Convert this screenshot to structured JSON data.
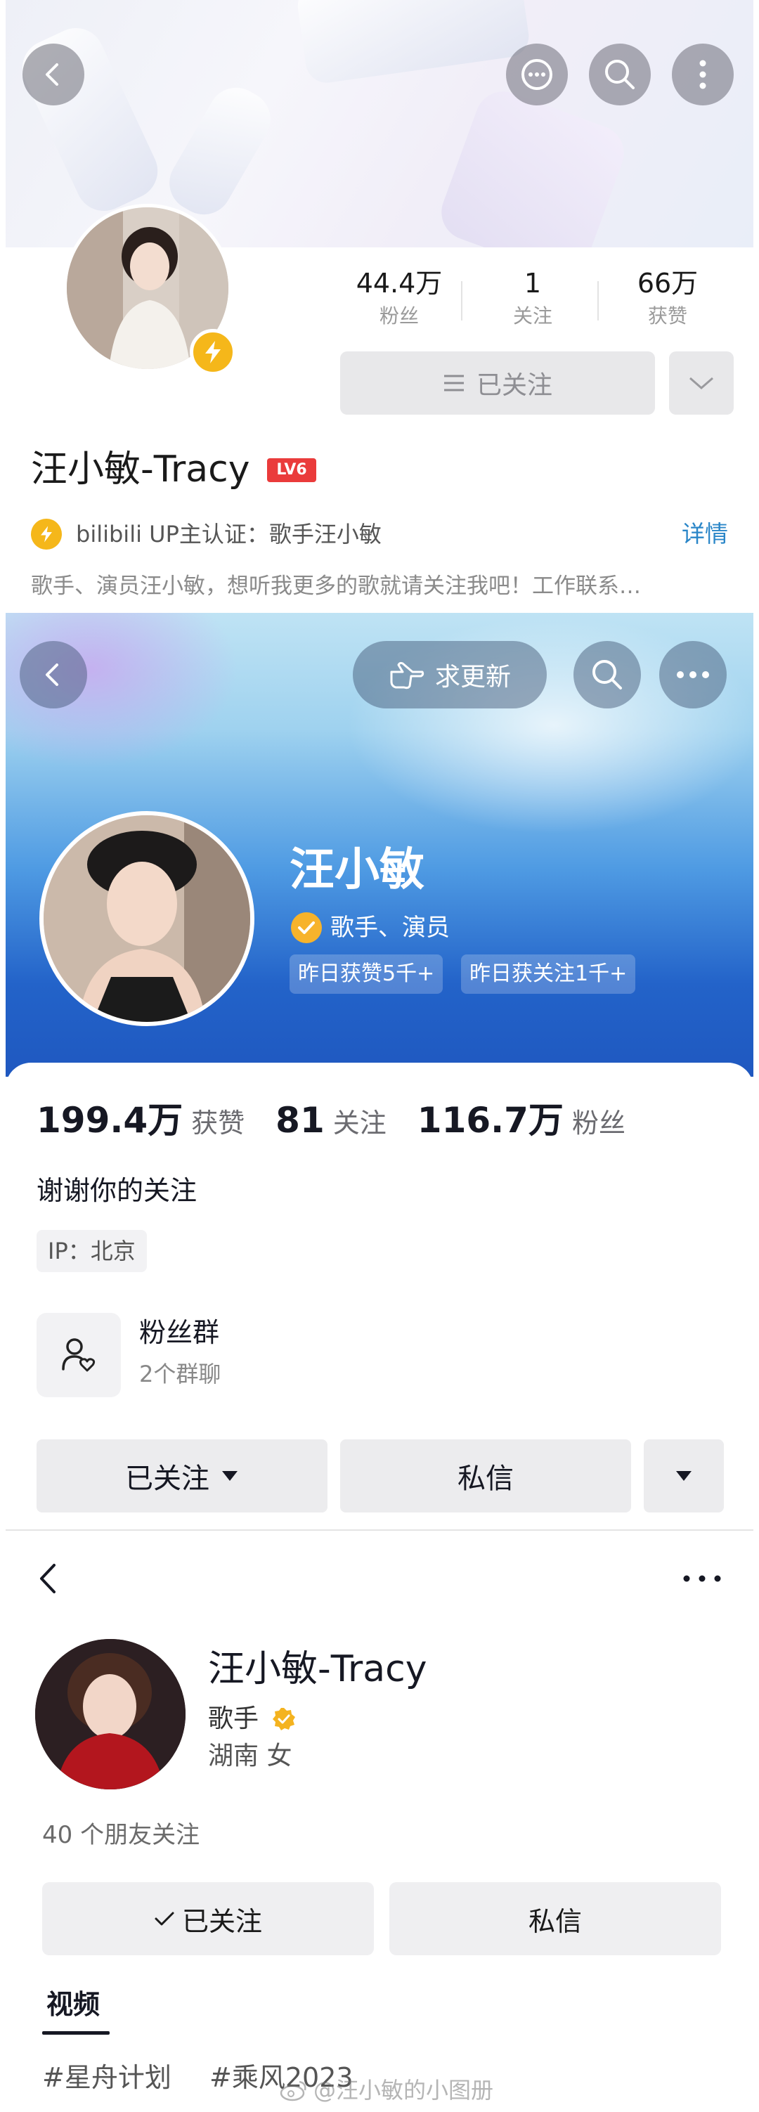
{
  "bilibili": {
    "stats": [
      {
        "value": "44.4万",
        "label": "粉丝"
      },
      {
        "value": "1",
        "label": "关注"
      },
      {
        "value": "66万",
        "label": "获赞"
      }
    ],
    "follow_label": "已关注",
    "name": "汪小敏-Tracy",
    "level": "LV6",
    "certification": "bilibili UP主认证：歌手汪小敏",
    "detail_link": "详情",
    "bio": "歌手、演员汪小敏，想听我更多的歌就请关注我吧！工作联系…",
    "icons": [
      "back-icon",
      "chat-icon",
      "search-icon",
      "more-vertical-icon",
      "lightning-icon",
      "list-icon",
      "chevron-down-icon"
    ]
  },
  "douyin": {
    "request_update": "求更新",
    "name": "汪小敏",
    "role": "歌手、演员",
    "tags": [
      "昨日获赞5千+",
      "昨日获关注1千+"
    ],
    "stats": [
      {
        "value": "199.4万",
        "label": "获赞"
      },
      {
        "value": "81",
        "label": "关注"
      },
      {
        "value": "116.7万",
        "label": "粉丝"
      }
    ],
    "bio": "谢谢你的关注",
    "ip": "IP：北京",
    "group": {
      "title": "粉丝群",
      "subtitle": "2个群聊"
    },
    "buttons": {
      "followed": "已关注",
      "message": "私信"
    },
    "icons": [
      "back-icon",
      "hand-point-icon",
      "search-icon",
      "more-horizontal-icon",
      "verified-icon",
      "fan-group-icon",
      "caret-down-icon"
    ],
    "colors": {
      "header_top": "#bfe3f4",
      "header_bottom": "#1f58c0",
      "verified": "#f7b32b"
    }
  },
  "weibo": {
    "name": "汪小敏-Tracy",
    "role": "歌手",
    "location": "湖南 女",
    "friends_following": "40 个朋友关注",
    "buttons": {
      "followed": "已关注",
      "message": "私信"
    },
    "tab": "视频",
    "hashtags": [
      "#星舟计划",
      "#乘风2023"
    ],
    "watermark": "@汪小敏的小图册",
    "icons": [
      "back-icon",
      "more-horizontal-icon",
      "verified-icon",
      "check-icon",
      "weibo-logo-icon"
    ]
  }
}
